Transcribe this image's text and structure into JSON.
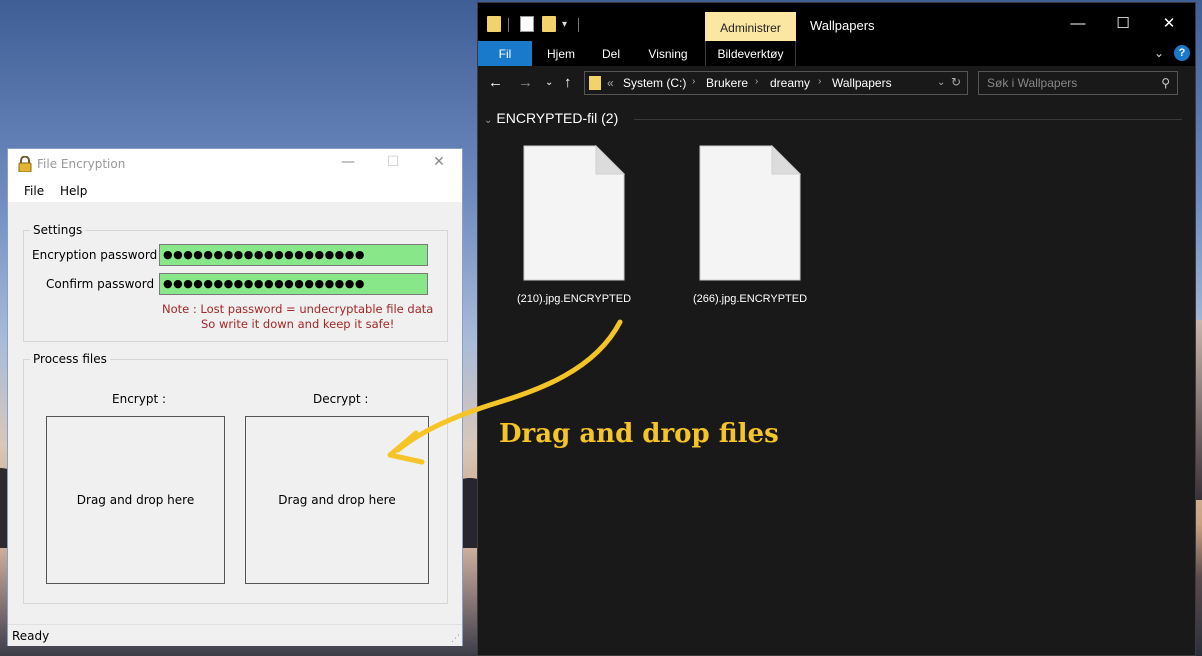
{
  "explorer": {
    "title": "Wallpapers",
    "context_tab": "Administrer",
    "ribbon_tabs": [
      "Fil",
      "Hjem",
      "Del",
      "Visning",
      "Bildeverktøy"
    ],
    "window_controls": [
      "minimize-icon",
      "maximize-icon",
      "close-icon"
    ],
    "breadcrumb": [
      "System (C:)",
      "Brukere",
      "dreamy",
      "Wallpapers"
    ],
    "breadcrumb_overflow": "«",
    "search_placeholder": "Søk i Wallpapers",
    "group_header": "ENCRYPTED-fil (2)",
    "files": [
      {
        "name": "(210).jpg.ENCRYPTED"
      },
      {
        "name": "(266).jpg.ENCRYPTED"
      }
    ]
  },
  "app": {
    "title": "File Encryption",
    "menu": [
      "File",
      "Help"
    ],
    "settings": {
      "legend": "Settings",
      "encryption_label": "Encryption password :",
      "confirm_label": "Confirm password :",
      "encryption_value": "●●●●●●●●●●●●●●●●●●●●",
      "confirm_value": "●●●●●●●●●●●●●●●●●●●●",
      "note_line1": "Note :  Lost password = undecryptable file data",
      "note_line2": "So write it down and keep it safe!",
      "field_color": "#88e788",
      "note_color": "#a52727"
    },
    "process": {
      "legend": "Process files",
      "encrypt_label": "Encrypt :",
      "decrypt_label": "Decrypt :",
      "encrypt_drop": "Drag and drop here",
      "decrypt_drop": "Drag and drop here"
    },
    "status": "Ready"
  },
  "annotation": {
    "text": "Drag and drop files",
    "color": "#f5c427"
  }
}
